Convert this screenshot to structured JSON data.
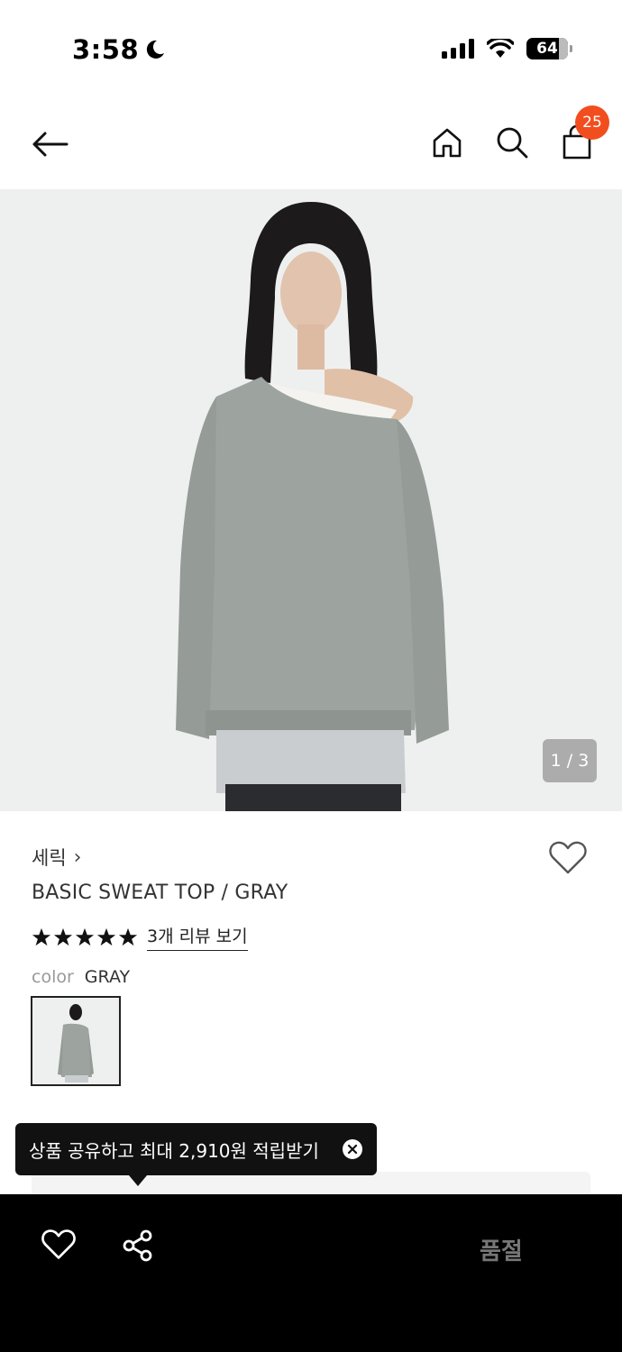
{
  "status_bar": {
    "time": "3:58",
    "battery": "64",
    "icons": [
      "moon-icon",
      "signal-icon",
      "wifi-icon",
      "battery-icon"
    ]
  },
  "nav": {
    "icons": [
      "back-arrow-icon",
      "home-icon",
      "search-icon",
      "shopping-bag-icon"
    ],
    "cart_count": "25"
  },
  "gallery": {
    "counter": "1 / 3"
  },
  "product": {
    "brand": "세릭",
    "brand_chevron": "›",
    "name": "BASIC SWEAT TOP / GRAY",
    "rating_stars": 5,
    "review_link": "3개 리뷰 보기",
    "color_label": "color",
    "color_value": "GRAY"
  },
  "tooltip": {
    "text": "상품 공유하고 최대 2,910원 적립받기"
  },
  "bottom_bar": {
    "status_label": "품절"
  },
  "colors": {
    "badge": "#f24d1f",
    "bottom_bar": "#000000",
    "soldout_text": "#777777"
  }
}
